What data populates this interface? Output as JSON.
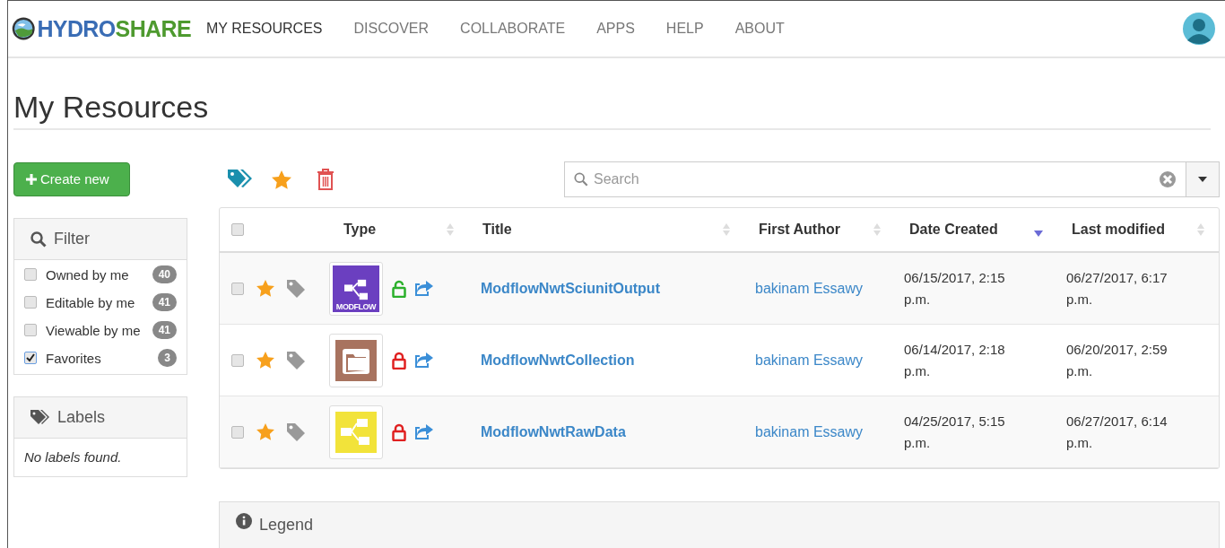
{
  "navbar": {
    "logo": {
      "part_1": "HYDRO",
      "part_2": "SHARE"
    },
    "items": [
      {
        "label": "MY RESOURCES",
        "selected": true
      },
      {
        "label": "DISCOVER",
        "selected": false
      },
      {
        "label": "COLLABORATE",
        "selected": false
      },
      {
        "label": "APPS",
        "selected": false
      },
      {
        "label": "HELP",
        "selected": false
      },
      {
        "label": "ABOUT",
        "selected": false
      }
    ]
  },
  "page_title": "My Resources",
  "sidebar": {
    "create_button": "Create new",
    "filter": {
      "title": "Filter",
      "items": [
        {
          "label": "Owned by me",
          "count": "40",
          "checked": false
        },
        {
          "label": "Editable by me",
          "count": "41",
          "checked": false
        },
        {
          "label": "Viewable by me",
          "count": "41",
          "checked": false
        },
        {
          "label": "Favorites",
          "count": "3",
          "checked": true
        }
      ]
    },
    "labels": {
      "title": "Labels",
      "empty_message": "No labels found."
    }
  },
  "search": {
    "placeholder": "Search"
  },
  "table": {
    "select_all_checked": false,
    "columns": [
      {
        "label": "Type",
        "kind": "sortable"
      },
      {
        "label": "Title",
        "kind": "sortable"
      },
      {
        "label": "First Author",
        "kind": "sortable"
      },
      {
        "label": "Date Created",
        "kind": "sorted"
      },
      {
        "label": "Last modified",
        "kind": "sortable"
      }
    ],
    "rows": [
      {
        "checked": false,
        "favorite": true,
        "kind": "modflow",
        "type_label": "MODFLOW",
        "locked": false,
        "title": "ModflowNwtSciunitOutput",
        "author": "bakinam Essawy",
        "created": "06/15/2017, 2:15 p.m.",
        "modified": "06/27/2017, 6:17 p.m."
      },
      {
        "checked": false,
        "favorite": true,
        "kind": "collection",
        "locked": true,
        "title": "ModflowNwtCollection",
        "author": "bakinam Essawy",
        "created": "06/14/2017, 2:18 p.m.",
        "modified": "06/20/2017, 2:59 p.m."
      },
      {
        "checked": false,
        "favorite": true,
        "kind": "composite",
        "locked": true,
        "title": "ModflowNwtRawData",
        "author": "bakinam Essawy",
        "created": "04/25/2017, 5:15 p.m.",
        "modified": "06/27/2017, 6:14 p.m."
      }
    ]
  },
  "legend": {
    "title": "Legend"
  }
}
